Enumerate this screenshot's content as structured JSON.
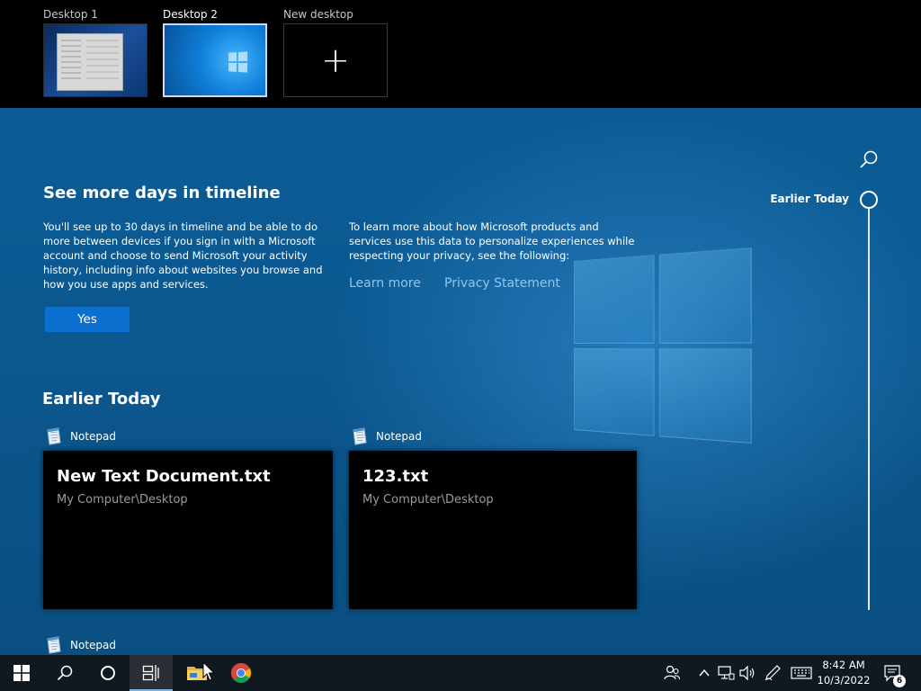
{
  "virtual_desktops": [
    {
      "label": "Desktop 1"
    },
    {
      "label": "Desktop 2"
    },
    {
      "label": "New desktop"
    }
  ],
  "timeline_header": {
    "label": "Earlier Today"
  },
  "promo": {
    "title": "See more days in timeline",
    "body": "You'll see up to 30 days in timeline and be able to do more between devices if you sign in with a Microsoft account and choose to send Microsoft your activity history, including info about websites you browse and how you use apps and services.",
    "privacy_text": "To learn more about how Microsoft products and services use this data to personalize experiences while respecting your privacy, see the following:",
    "learn_more": "Learn more",
    "privacy_statement": "Privacy Statement",
    "yes_label": "Yes"
  },
  "section": {
    "title": "Earlier Today"
  },
  "activities": [
    {
      "app": "Notepad",
      "title": "New Text Document.txt",
      "path": "My Computer\\Desktop"
    },
    {
      "app": "Notepad",
      "title": "123.txt",
      "path": "My Computer\\Desktop"
    },
    {
      "app": "Notepad"
    }
  ],
  "taskbar": {
    "clock_time": "8:42 AM",
    "clock_date": "10/3/2022",
    "notification_count": "6"
  },
  "colors": {
    "accent": "#0b6fd0",
    "link": "#8fc6f0",
    "timeline_bg": "#0b5c96",
    "taskbar_bg": "#101820"
  },
  "icons": [
    "search-icon",
    "notepad-icon",
    "windows-start-icon",
    "cortana-icon",
    "task-view-icon",
    "file-explorer-icon",
    "chrome-icon",
    "people-icon",
    "chevron-up-icon",
    "network-icon",
    "volume-icon",
    "pen-icon",
    "keyboard-icon",
    "notification-icon"
  ]
}
